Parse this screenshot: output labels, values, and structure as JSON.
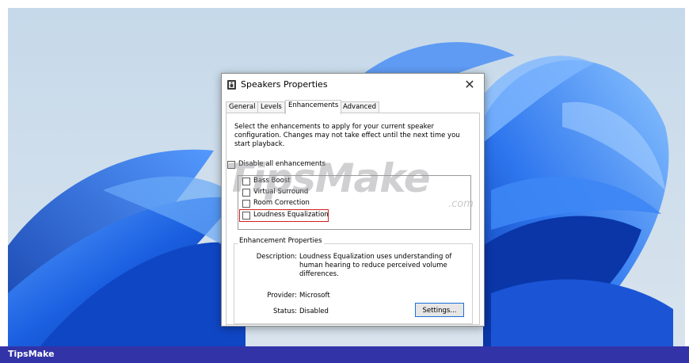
{
  "dialog": {
    "title": "Speakers Properties",
    "close_glyph": "✕",
    "tabs": [
      {
        "label": "General",
        "active": false
      },
      {
        "label": "Levels",
        "active": false
      },
      {
        "label": "Enhancements",
        "active": true
      },
      {
        "label": "Advanced",
        "active": false
      }
    ],
    "instructions": "Select the enhancements to apply for your current speaker configuration. Changes may not take effect until the next time you start playback.",
    "disable_all_label": "Disable all enhancements",
    "enhancements": [
      {
        "label": "Bass Boost",
        "checked": false
      },
      {
        "label": "Virtual Surround",
        "checked": false
      },
      {
        "label": "Room Correction",
        "checked": false
      },
      {
        "label": "Loudness Equalization",
        "checked": false,
        "highlighted": true
      }
    ],
    "properties": {
      "group_title": "Enhancement Properties",
      "description_label": "Description:",
      "description_value": "Loudness Equalization uses understanding of human hearing to reduce perceived volume differences.",
      "provider_label": "Provider:",
      "provider_value": "Microsoft",
      "status_label": "Status:",
      "status_value": "Disabled",
      "settings_button": "Settings..."
    }
  },
  "watermark": {
    "text": "TipsMake",
    "suffix": ".com"
  },
  "footer": {
    "brand": "TipsMake"
  },
  "colors": {
    "footer_bg": "#3333a8",
    "highlight_border": "#d42020",
    "wallpaper_blue": "#1f5fd6",
    "button_focus": "#1a6fd8"
  },
  "icons": {
    "dialog_icon": "speaker-icon",
    "close": "close-icon"
  }
}
